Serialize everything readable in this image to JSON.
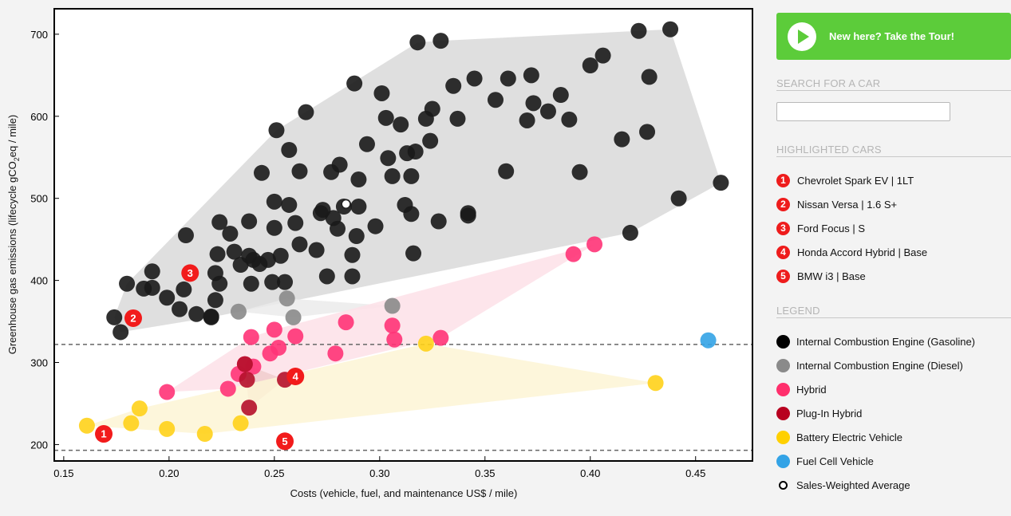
{
  "chart_data": {
    "type": "scatter",
    "title": "",
    "xlabel": "Costs (vehicle, fuel, and maintenance US$ / mile)",
    "ylabel_parts": [
      "Greenhouse gas emissions (lifecycle gCO",
      "2",
      "eq / mile)"
    ],
    "xlim": [
      0.1455,
      0.477
    ],
    "ylim": [
      180,
      731
    ],
    "xticks": [
      0.15,
      0.2,
      0.25,
      0.3,
      0.35,
      0.4,
      0.45
    ],
    "xtick_labels": [
      "0.15",
      "0.20",
      "0.25",
      "0.30",
      "0.35",
      "0.40",
      "0.45"
    ],
    "yticks": [
      200,
      300,
      400,
      500,
      600,
      700
    ],
    "ytick_labels": [
      "200",
      "300",
      "400",
      "500",
      "600",
      "700"
    ],
    "grid": false,
    "reference_lines": [
      322,
      193
    ],
    "series": [
      {
        "name": "Internal Combustion Engine (Gasoline)",
        "color": "#1a1a1a",
        "hull_color": "#d9d9d9",
        "points": [
          [
            0.174,
            355
          ],
          [
            0.177,
            337
          ],
          [
            0.18,
            396
          ],
          [
            0.188,
            390
          ],
          [
            0.192,
            391
          ],
          [
            0.192,
            411
          ],
          [
            0.199,
            379
          ],
          [
            0.205,
            365
          ],
          [
            0.207,
            389
          ],
          [
            0.208,
            455
          ],
          [
            0.213,
            359
          ],
          [
            0.22,
            356
          ],
          [
            0.22,
            355
          ],
          [
            0.222,
            376
          ],
          [
            0.222,
            409
          ],
          [
            0.223,
            432
          ],
          [
            0.224,
            396
          ],
          [
            0.224,
            471
          ],
          [
            0.229,
            457
          ],
          [
            0.231,
            435
          ],
          [
            0.234,
            419
          ],
          [
            0.238,
            472
          ],
          [
            0.238,
            430
          ],
          [
            0.239,
            396
          ],
          [
            0.24,
            425
          ],
          [
            0.243,
            420
          ],
          [
            0.244,
            531
          ],
          [
            0.247,
            425
          ],
          [
            0.249,
            398
          ],
          [
            0.25,
            464
          ],
          [
            0.25,
            496
          ],
          [
            0.251,
            583
          ],
          [
            0.253,
            430
          ],
          [
            0.255,
            398
          ],
          [
            0.257,
            559
          ],
          [
            0.257,
            492
          ],
          [
            0.26,
            470
          ],
          [
            0.262,
            444
          ],
          [
            0.262,
            533
          ],
          [
            0.265,
            605
          ],
          [
            0.27,
            437
          ],
          [
            0.272,
            482
          ],
          [
            0.273,
            486
          ],
          [
            0.275,
            405
          ],
          [
            0.277,
            532
          ],
          [
            0.278,
            476
          ],
          [
            0.28,
            463
          ],
          [
            0.281,
            541
          ],
          [
            0.283,
            490
          ],
          [
            0.287,
            405
          ],
          [
            0.287,
            431
          ],
          [
            0.288,
            640
          ],
          [
            0.289,
            454
          ],
          [
            0.29,
            490
          ],
          [
            0.29,
            523
          ],
          [
            0.294,
            566
          ],
          [
            0.298,
            466
          ],
          [
            0.301,
            628
          ],
          [
            0.303,
            598
          ],
          [
            0.304,
            549
          ],
          [
            0.306,
            527
          ],
          [
            0.31,
            590
          ],
          [
            0.312,
            492
          ],
          [
            0.313,
            555
          ],
          [
            0.315,
            527
          ],
          [
            0.315,
            481
          ],
          [
            0.316,
            433
          ],
          [
            0.317,
            557
          ],
          [
            0.318,
            690
          ],
          [
            0.322,
            597
          ],
          [
            0.324,
            570
          ],
          [
            0.325,
            609
          ],
          [
            0.328,
            472
          ],
          [
            0.329,
            692
          ],
          [
            0.335,
            637
          ],
          [
            0.337,
            597
          ],
          [
            0.342,
            482
          ],
          [
            0.342,
            479
          ],
          [
            0.345,
            646
          ],
          [
            0.355,
            620
          ],
          [
            0.36,
            533
          ],
          [
            0.361,
            646
          ],
          [
            0.37,
            595
          ],
          [
            0.372,
            650
          ],
          [
            0.373,
            616
          ],
          [
            0.38,
            606
          ],
          [
            0.386,
            626
          ],
          [
            0.39,
            596
          ],
          [
            0.395,
            532
          ],
          [
            0.4,
            662
          ],
          [
            0.406,
            674
          ],
          [
            0.415,
            572
          ],
          [
            0.419,
            458
          ],
          [
            0.423,
            704
          ],
          [
            0.427,
            581
          ],
          [
            0.428,
            648
          ],
          [
            0.438,
            706
          ],
          [
            0.442,
            500
          ],
          [
            0.462,
            519
          ]
        ]
      },
      {
        "name": "Internal Combustion Engine (Diesel)",
        "color": "#8a8a8a",
        "hull_color": "#ebebeb",
        "points": [
          [
            0.233,
            362
          ],
          [
            0.256,
            378
          ],
          [
            0.259,
            355
          ],
          [
            0.306,
            369
          ]
        ]
      },
      {
        "name": "Hybrid",
        "color": "#ff3377",
        "hull_color": "#fde0e8",
        "points": [
          [
            0.199,
            264
          ],
          [
            0.228,
            268
          ],
          [
            0.233,
            286
          ],
          [
            0.236,
            298
          ],
          [
            0.239,
            331
          ],
          [
            0.24,
            295
          ],
          [
            0.248,
            311
          ],
          [
            0.25,
            340
          ],
          [
            0.252,
            318
          ],
          [
            0.26,
            332
          ],
          [
            0.279,
            311
          ],
          [
            0.284,
            349
          ],
          [
            0.306,
            345
          ],
          [
            0.307,
            328
          ],
          [
            0.329,
            330
          ],
          [
            0.392,
            432
          ],
          [
            0.402,
            444
          ]
        ]
      },
      {
        "name": "Plug-In Hybrid",
        "color": "#b5102a",
        "hull_color": "#f0cccc",
        "points": [
          [
            0.236,
            298
          ],
          [
            0.237,
            279
          ],
          [
            0.238,
            245
          ],
          [
            0.255,
            279
          ]
        ]
      },
      {
        "name": "Battery Electric Vehicle",
        "color": "#ffd21a",
        "hull_color": "#fdf5d5",
        "points": [
          [
            0.161,
            223
          ],
          [
            0.182,
            226
          ],
          [
            0.186,
            244
          ],
          [
            0.199,
            219
          ],
          [
            0.217,
            213
          ],
          [
            0.234,
            226
          ],
          [
            0.322,
            323
          ],
          [
            0.431,
            275
          ]
        ]
      },
      {
        "name": "Fuel Cell Vehicle",
        "color": "#33a3e6",
        "hull_color": "",
        "points": [
          [
            0.456,
            327
          ]
        ]
      }
    ],
    "sales_weighted_average": [
      0.284,
      493
    ],
    "highlighted": [
      {
        "label": "1",
        "x": 0.169,
        "y": 213
      },
      {
        "label": "2",
        "x": 0.183,
        "y": 354
      },
      {
        "label": "3",
        "x": 0.21,
        "y": 409
      },
      {
        "label": "4",
        "x": 0.26,
        "y": 283
      },
      {
        "label": "5",
        "x": 0.255,
        "y": 204
      }
    ]
  },
  "sidebar": {
    "tour_label": "New here? Take the Tour!",
    "search_title": "SEARCH FOR A CAR",
    "search_value": "",
    "highlighted_title": "HIGHLIGHTED CARS",
    "highlighted_cars": [
      {
        "num": "1",
        "name": "Chevrolet Spark EV | 1LT"
      },
      {
        "num": "2",
        "name": "Nissan Versa | 1.6 S+"
      },
      {
        "num": "3",
        "name": "Ford Focus | S"
      },
      {
        "num": "4",
        "name": "Honda Accord Hybrid | Base"
      },
      {
        "num": "5",
        "name": "BMW i3 | Base"
      }
    ],
    "legend_title": "LEGEND",
    "legend": [
      {
        "name": "Internal Combustion Engine (Gasoline)",
        "color": "#000000"
      },
      {
        "name": "Internal Combustion Engine (Diesel)",
        "color": "#8a8a8a"
      },
      {
        "name": "Hybrid",
        "color": "#ff2f6c"
      },
      {
        "name": "Plug-In Hybrid",
        "color": "#b8001f"
      },
      {
        "name": "Battery Electric Vehicle",
        "color": "#ffd000"
      },
      {
        "name": "Fuel Cell Vehicle",
        "color": "#33a3e6"
      },
      {
        "name": "Sales-Weighted Average",
        "color": "ring"
      }
    ]
  }
}
